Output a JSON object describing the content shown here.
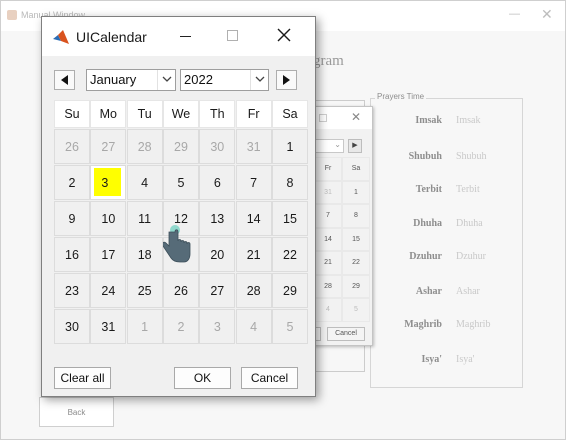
{
  "background_window": {
    "title": "Manual Window",
    "heading": "gram",
    "prayer_panel_title": "Prayers Time",
    "prayers": [
      {
        "name": "Imsak",
        "value": "Imsak"
      },
      {
        "name": "Shubuh",
        "value": "Shubuh"
      },
      {
        "name": "Terbit",
        "value": "Terbit"
      },
      {
        "name": "Dhuha",
        "value": "Dhuha"
      },
      {
        "name": "Dzuhur",
        "value": "Dzuhur"
      },
      {
        "name": "Ashar",
        "value": "Ashar"
      },
      {
        "name": "Maghrib",
        "value": "Maghrib"
      },
      {
        "name": "Isya'",
        "value": "Isya'"
      }
    ],
    "back_label": "Back"
  },
  "mid_window": {
    "close_glyph": "✕",
    "next_glyph": "▶",
    "dropdown_glyph": "⌄",
    "header": [
      "Fr",
      "Sa"
    ],
    "rows": [
      [
        "31",
        "1"
      ],
      [
        "7",
        "8"
      ],
      [
        "14",
        "15"
      ],
      [
        "21",
        "22"
      ],
      [
        "28",
        "29"
      ],
      [
        "4",
        "5"
      ]
    ],
    "cancel_label": "Cancel"
  },
  "calendar": {
    "title": "UICalendar",
    "month": "January",
    "year": "2022",
    "weekdays": [
      "Su",
      "Mo",
      "Tu",
      "We",
      "Th",
      "Fr",
      "Sa"
    ],
    "selected_day": "3",
    "weeks": [
      [
        {
          "d": "26",
          "dim": true
        },
        {
          "d": "27",
          "dim": true
        },
        {
          "d": "28",
          "dim": true
        },
        {
          "d": "29",
          "dim": true
        },
        {
          "d": "30",
          "dim": true
        },
        {
          "d": "31",
          "dim": true
        },
        {
          "d": "1",
          "dim": false
        }
      ],
      [
        {
          "d": "2",
          "dim": false
        },
        {
          "d": "3",
          "dim": false,
          "selected": true
        },
        {
          "d": "4",
          "dim": false
        },
        {
          "d": "5",
          "dim": false
        },
        {
          "d": "6",
          "dim": false
        },
        {
          "d": "7",
          "dim": false
        },
        {
          "d": "8",
          "dim": false
        }
      ],
      [
        {
          "d": "9",
          "dim": false
        },
        {
          "d": "10",
          "dim": false
        },
        {
          "d": "11",
          "dim": false
        },
        {
          "d": "12",
          "dim": false
        },
        {
          "d": "13",
          "dim": false
        },
        {
          "d": "14",
          "dim": false
        },
        {
          "d": "15",
          "dim": false
        }
      ],
      [
        {
          "d": "16",
          "dim": false
        },
        {
          "d": "17",
          "dim": false
        },
        {
          "d": "18",
          "dim": false
        },
        {
          "d": "19",
          "dim": false
        },
        {
          "d": "20",
          "dim": false
        },
        {
          "d": "21",
          "dim": false
        },
        {
          "d": "22",
          "dim": false
        }
      ],
      [
        {
          "d": "23",
          "dim": false
        },
        {
          "d": "24",
          "dim": false
        },
        {
          "d": "25",
          "dim": false
        },
        {
          "d": "26",
          "dim": false
        },
        {
          "d": "27",
          "dim": false
        },
        {
          "d": "28",
          "dim": false
        },
        {
          "d": "29",
          "dim": false
        }
      ],
      [
        {
          "d": "30",
          "dim": false
        },
        {
          "d": "31",
          "dim": false
        },
        {
          "d": "1",
          "dim": true
        },
        {
          "d": "2",
          "dim": true
        },
        {
          "d": "3",
          "dim": true
        },
        {
          "d": "4",
          "dim": true
        },
        {
          "d": "5",
          "dim": true
        }
      ]
    ],
    "clear_all_label": "Clear all",
    "ok_label": "OK",
    "cancel_label": "Cancel"
  },
  "colors": {
    "selected_highlight": "#ffff00",
    "window_bg": "#f0f0f0",
    "matlab_orange": "#d9531e",
    "matlab_blue": "#2a6cb5"
  },
  "icons": [
    "matlab-icon",
    "minimize-icon",
    "maximize-icon",
    "close-icon",
    "chevron-down-icon",
    "prev-arrow-icon",
    "next-arrow-icon",
    "hand-cursor-icon"
  ]
}
